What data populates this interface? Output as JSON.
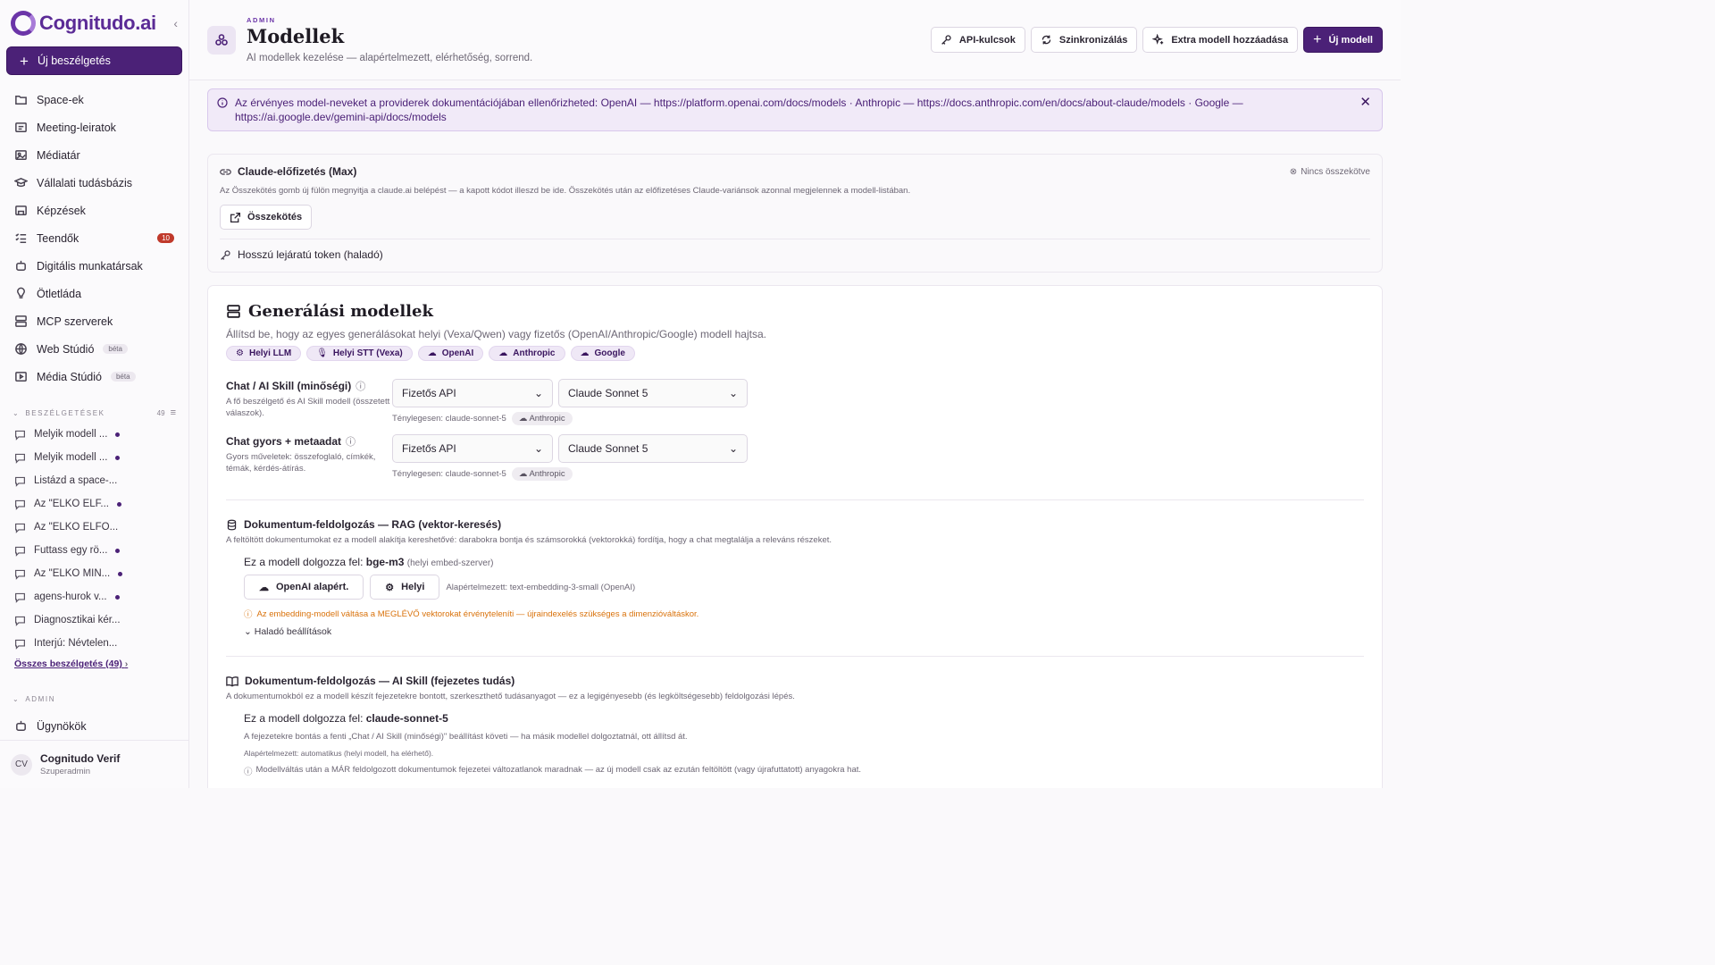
{
  "brand": {
    "name": "Cognitudo.ai"
  },
  "sidebar": {
    "new_chat": "Új beszélgetés",
    "items": [
      {
        "label": "Space-ek",
        "icon": "folder-icon"
      },
      {
        "label": "Meeting-leiratok",
        "icon": "transcript-icon"
      },
      {
        "label": "Médiatár",
        "icon": "image-icon"
      },
      {
        "label": "Vállalati tudásbázis",
        "icon": "graduation-cap-icon"
      },
      {
        "label": "Képzések",
        "icon": "training-icon"
      },
      {
        "label": "Teendők",
        "icon": "checklist-icon",
        "badge": "10"
      },
      {
        "label": "Digitális munkatársak",
        "icon": "bot-icon"
      },
      {
        "label": "Ötletláda",
        "icon": "lightbulb-icon"
      },
      {
        "label": "MCP szerverek",
        "icon": "server-icon"
      },
      {
        "label": "Web Stúdió",
        "icon": "globe-icon",
        "tag": "béta"
      },
      {
        "label": "Média Stúdió",
        "icon": "media-icon",
        "tag": "béta"
      }
    ],
    "conversations_heading": "BESZÉLGETÉSEK",
    "conversations_count": "49",
    "conversations": [
      {
        "label": "Melyik modell ...",
        "dot": true
      },
      {
        "label": "Melyik modell ...",
        "dot": true
      },
      {
        "label": "Listázd a space-...",
        "dot": false
      },
      {
        "label": "Az \"ELKO ELF...",
        "dot": true
      },
      {
        "label": "Az \"ELKO ELFO...",
        "dot": false
      },
      {
        "label": "Futtass egy rö...",
        "dot": true
      },
      {
        "label": "Az \"ELKO MIN...",
        "dot": true
      },
      {
        "label": "agens-hurok v...",
        "dot": true
      },
      {
        "label": "Diagnosztikai kér...",
        "dot": false
      },
      {
        "label": "Interjú: Névtelen...",
        "dot": false
      }
    ],
    "all_conversations": "Összes beszélgetés (49)",
    "admin_heading": "ADMIN",
    "admin_items": [
      {
        "label": "Ügynökök"
      }
    ],
    "user": {
      "initials": "CV",
      "name": "Cognitudo Verif",
      "role": "Szuperadmin"
    }
  },
  "header": {
    "kicker": "ADMIN",
    "title": "Modellek",
    "subtitle": "AI modellek kezelése — alapértelmezett, elérhetőség, sorrend.",
    "buttons": {
      "api_keys": "API-kulcsok",
      "sync": "Szinkronizálás",
      "extra": "Extra modell hozzáadása",
      "new_model": "Új modell"
    }
  },
  "banner": {
    "text": "Az érvényes model-neveket a providerek dokumentációjában ellenőrizheted: OpenAI — https://platform.openai.com/docs/models · Anthropic — https://docs.anthropic.com/en/docs/about-claude/models · Google — https://ai.google.dev/gemini-api/docs/models"
  },
  "claude": {
    "title": "Claude-előfizetés (Max)",
    "status": "Nincs összekötve",
    "desc": "Az Összekötés gomb új fülön megnyitja a claude.ai belépést — a kapott kódot illeszd be ide. Összekötés után az előfizetéses Claude-variánsok azonnal megjelennek a modell-listában.",
    "connect": "Összekötés",
    "token": "Hosszú lejáratú token (haladó)"
  },
  "gen": {
    "title": "Generálási modellek",
    "subtitle": "Állítsd be, hogy az egyes generálásokat helyi (Vexa/Qwen) vagy fizetős (OpenAI/Anthropic/Google) modell hajtsa.",
    "chips": [
      "Helyi LLM",
      "Helyi STT (Vexa)",
      "OpenAI",
      "Anthropic",
      "Google"
    ],
    "rows": [
      {
        "title": "Chat / AI Skill (minőségi)",
        "desc": "A fő beszélgető és AI Skill modell (összetett válaszok).",
        "source": "Fizetős API",
        "model": "Claude Sonnet 5",
        "effective": "Ténylegesen: claude-sonnet-5",
        "provider": "Anthropic"
      },
      {
        "title": "Chat gyors + metaadat",
        "desc": "Gyors műveletek: összefoglaló, címkék, témák, kérdés-átírás.",
        "source": "Fizetős API",
        "model": "Claude Sonnet 5",
        "effective": "Ténylegesen: claude-sonnet-5",
        "provider": "Anthropic"
      }
    ],
    "rag": {
      "title": "Dokumentum-feldolgozás — RAG (vektor-keresés)",
      "desc": "A feltöltött dokumentumokat ez a modell alakítja kereshetővé: darabokra bontja és számsorokká (vektorokká) fordítja, hogy a chat megtalálja a releváns részeket.",
      "worker_prefix": "Ez a modell dolgozza fel:",
      "worker_model": "bge-m3",
      "worker_meta": "(helyi embed-szerver)",
      "btn_openai": "OpenAI alapért.",
      "btn_local": "Helyi",
      "default": "Alapértelmezett: text-embedding-3-small (OpenAI)",
      "warning": "Az embedding-modell váltása a MEGLÉVŐ vektorokat érvényteleníti — újraindexelés szükséges a dimenzióváltáskor.",
      "advanced": "Haladó beállítások"
    },
    "skill": {
      "title": "Dokumentum-feldolgozás — AI Skill (fejezetes tudás)",
      "desc": "A dokumentumokból ez a modell készít fejezetekre bontott, szerkeszthető tudásanyagot — ez a legigényesebb (és legköltségesebb) feldolgozási lépés.",
      "worker_prefix": "Ez a modell dolgozza fel:",
      "worker_model": "claude-sonnet-5",
      "note1": "A fejezetekre bontás a fenti „Chat / AI Skill (minőségi)\" beállítást követi — ha másik modellel dolgoztatnál, ott állítsd át.",
      "note2": "Alapértelmezett: automatikus (helyi modell, ha elérhető).",
      "note3": "Modellváltás után a MÁR feldolgozott dokumentumok fejezetei változatlanok maradnak — az új modell csak az ezután feltöltött (vagy újrafuttatott) anyagokra hat."
    }
  },
  "colors": {
    "accent": "#4b2177",
    "warning": "#d9720b",
    "badge": "#c0392b"
  }
}
